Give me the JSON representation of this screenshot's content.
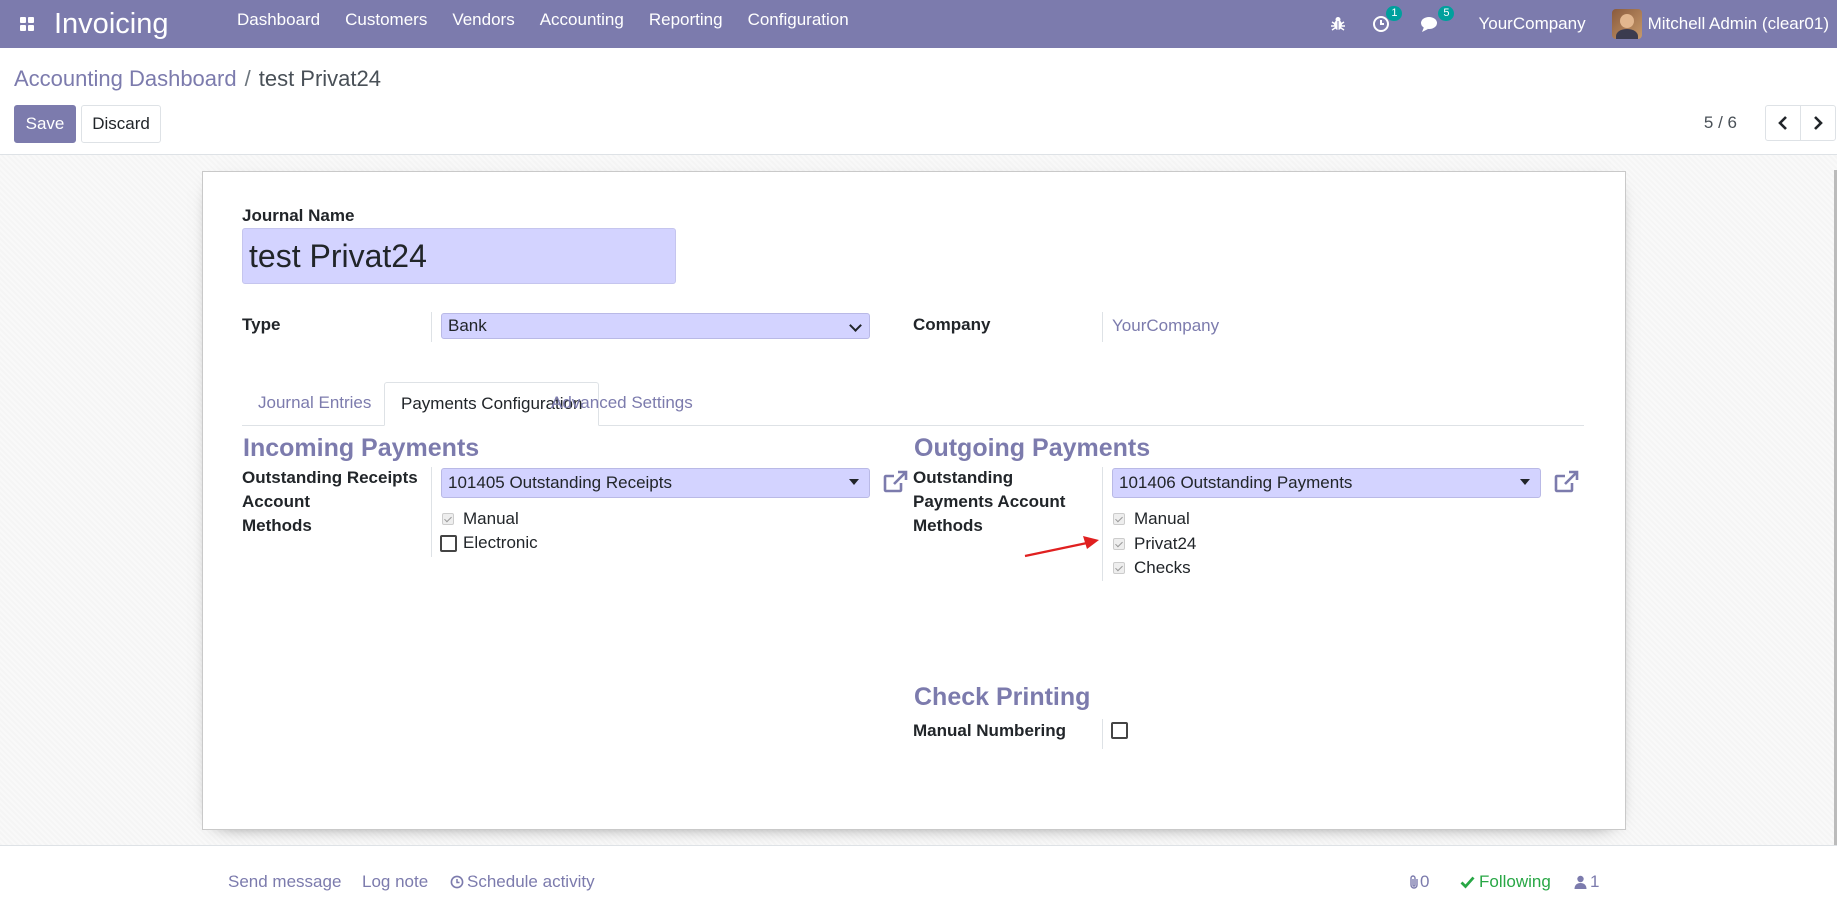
{
  "navbar": {
    "app_title": "Invoicing",
    "menu": [
      "Dashboard",
      "Customers",
      "Vendors",
      "Accounting",
      "Reporting",
      "Configuration"
    ],
    "activity_count": "1",
    "message_count": "5",
    "company": "YourCompany",
    "user": "Mitchell Admin (clear01)"
  },
  "breadcrumb": {
    "parent": "Accounting Dashboard",
    "separator": "/",
    "current": "test Privat24"
  },
  "buttons": {
    "save": "Save",
    "discard": "Discard"
  },
  "pager": {
    "value": "5 / 6"
  },
  "form": {
    "journal_name_label": "Journal Name",
    "journal_name": "test Privat24",
    "type_label": "Type",
    "type_value": "Bank",
    "company_label": "Company",
    "company_value": "YourCompany",
    "tabs": [
      "Journal Entries",
      "Payments Configuration",
      "Advanced Settings"
    ],
    "incoming": {
      "title": "Incoming Payments",
      "account_label_1": "Outstanding Receipts",
      "account_label_2": "Account",
      "account_value": "101405 Outstanding Receipts",
      "methods_label": "Methods",
      "methods": [
        {
          "label": "Manual",
          "checked": true,
          "readonly": true
        },
        {
          "label": "Electronic",
          "checked": false,
          "readonly": false
        }
      ]
    },
    "outgoing": {
      "title": "Outgoing Payments",
      "account_label_1": "Outstanding",
      "account_label_2": "Payments Account",
      "account_value": "101406 Outstanding Payments",
      "methods_label": "Methods",
      "methods": [
        {
          "label": "Manual",
          "checked": true,
          "readonly": true
        },
        {
          "label": "Privat24",
          "checked": true,
          "readonly": true
        },
        {
          "label": "Checks",
          "checked": true,
          "readonly": true
        }
      ]
    },
    "check_printing": {
      "title": "Check Printing",
      "manual_numbering_label": "Manual Numbering",
      "manual_numbering": false
    }
  },
  "chatter": {
    "send_message": "Send message",
    "log_note": "Log note",
    "schedule_activity": "Schedule activity",
    "attachments": "0",
    "following": "Following",
    "followers": "1"
  },
  "colors": {
    "brand": "#7c7bad",
    "input_bg": "#d3d3ff",
    "following": "#28a745",
    "badge": "#00a09d",
    "annotation_arrow": "#e02020"
  }
}
